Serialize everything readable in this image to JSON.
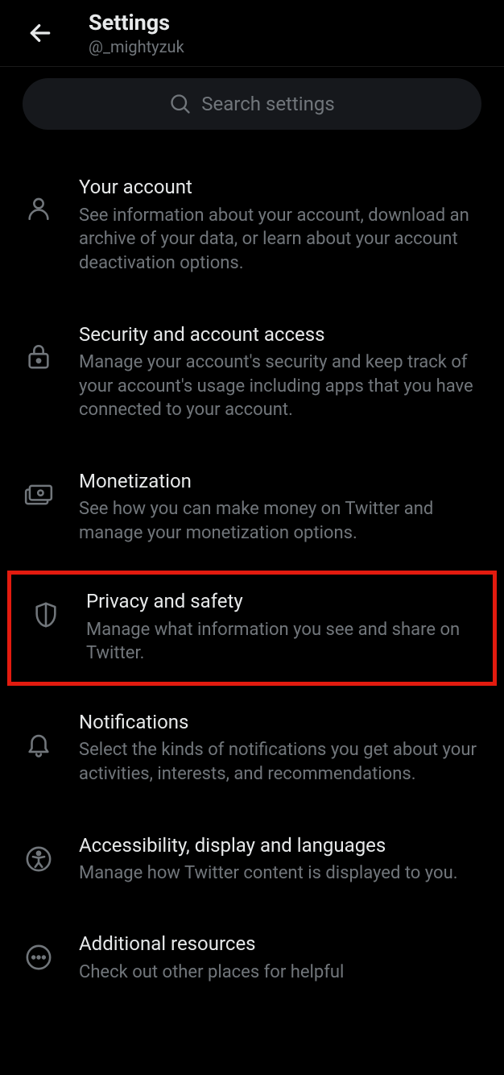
{
  "header": {
    "title": "Settings",
    "subtitle": "@_mightyzuk"
  },
  "search": {
    "placeholder": "Search settings"
  },
  "items": [
    {
      "title": "Your account",
      "description": "See information about your account, download an archive of your data, or learn about your account deactivation options."
    },
    {
      "title": "Security and account access",
      "description": "Manage your account's security and keep track of your account's usage including apps that you have connected to your account."
    },
    {
      "title": "Monetization",
      "description": "See how you can make money on Twitter and manage your monetization options."
    },
    {
      "title": "Privacy and safety",
      "description": "Manage what information you see and share on Twitter."
    },
    {
      "title": "Notifications",
      "description": "Select the kinds of notifications you get about your activities, interests, and recommendations."
    },
    {
      "title": "Accessibility, display and languages",
      "description": "Manage how Twitter content is displayed to you."
    },
    {
      "title": "Additional resources",
      "description": "Check out other places for helpful"
    }
  ]
}
